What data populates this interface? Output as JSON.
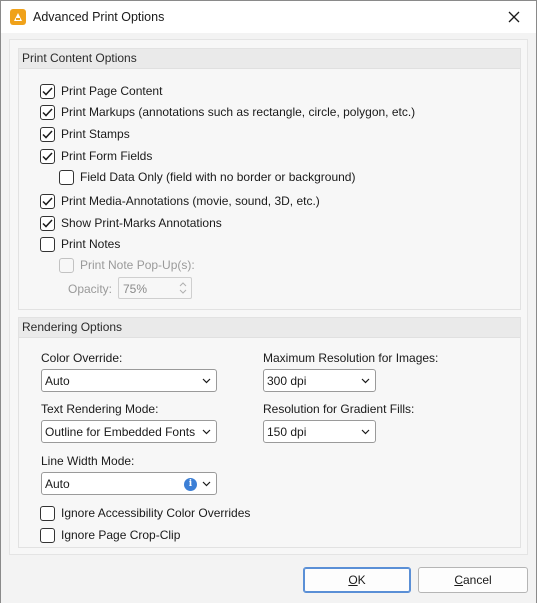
{
  "window": {
    "title": "Advanced Print Options",
    "icon": "pdf-editor-app-icon",
    "close_icon": "close-icon"
  },
  "print_content": {
    "header": "Print Content Options",
    "print_page_content": {
      "label": "Print Page Content",
      "checked": true
    },
    "print_markups": {
      "label": "Print Markups (annotations such as rectangle, circle, polygon, etc.)",
      "checked": true
    },
    "print_stamps": {
      "label": "Print Stamps",
      "checked": true
    },
    "print_form_fields": {
      "label": "Print Form Fields",
      "checked": true
    },
    "field_data_only": {
      "label": "Field Data Only (field with no border or background)",
      "checked": false
    },
    "print_media": {
      "label": "Print Media-Annotations (movie, sound, 3D, etc.)",
      "checked": true
    },
    "show_print_marks": {
      "label": "Show Print-Marks Annotations",
      "checked": true
    },
    "print_notes": {
      "label": "Print Notes",
      "checked": false
    },
    "print_note_popups": {
      "label": "Print Note Pop-Up(s):",
      "checked": false,
      "disabled": true
    },
    "opacity": {
      "label": "Opacity:",
      "value": "75%",
      "disabled": true
    }
  },
  "rendering": {
    "header": "Rendering Options",
    "color_override": {
      "label": "Color Override:",
      "value": "Auto"
    },
    "text_rendering_mode": {
      "label": "Text Rendering Mode:",
      "value": "Outline for Embedded Fonts"
    },
    "line_width_mode": {
      "label": "Line Width Mode:",
      "value": "Auto",
      "info_icon": "info-icon"
    },
    "max_resolution": {
      "label": "Maximum Resolution for Images:",
      "value": "300 dpi"
    },
    "gradient_resolution": {
      "label": "Resolution for Gradient Fills:",
      "value": "150 dpi"
    },
    "ignore_accessibility": {
      "label": "Ignore Accessibility Color Overrides",
      "checked": false
    },
    "ignore_crop_clip": {
      "label": "Ignore Page Crop-Clip",
      "checked": false
    }
  },
  "buttons": {
    "ok": {
      "label": "OK",
      "mnemonic": "O",
      "rest": "K"
    },
    "cancel": {
      "label": "Cancel",
      "mnemonic": "C",
      "rest": "ancel"
    }
  },
  "colors": {
    "accent": "#5a8fd6",
    "info": "#3c7fd6",
    "app_icon": "#f0a21a"
  }
}
